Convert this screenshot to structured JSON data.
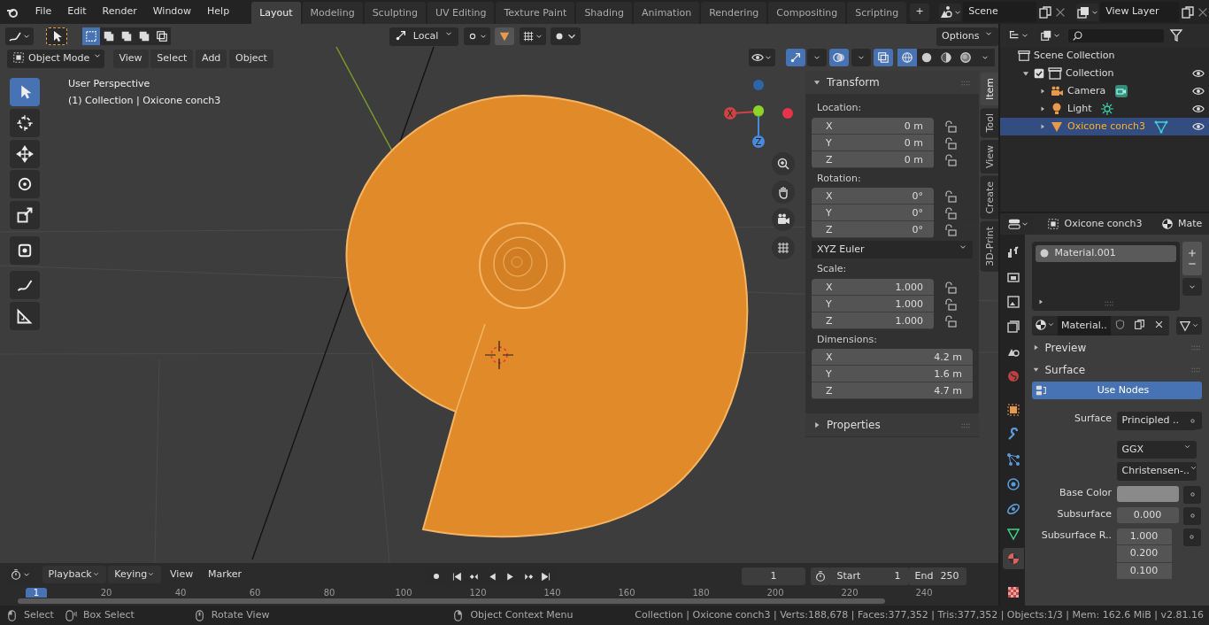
{
  "menu": [
    "File",
    "Edit",
    "Render",
    "Window",
    "Help"
  ],
  "workspaces": [
    {
      "label": "Layout",
      "selected": true
    },
    {
      "label": "Modeling",
      "selected": false
    },
    {
      "label": "Sculpting",
      "selected": false
    },
    {
      "label": "UV Editing",
      "selected": false
    },
    {
      "label": "Texture Paint",
      "selected": false
    },
    {
      "label": "Shading",
      "selected": false
    },
    {
      "label": "Animation",
      "selected": false
    },
    {
      "label": "Rendering",
      "selected": false
    },
    {
      "label": "Compositing",
      "selected": false
    },
    {
      "label": "Scripting",
      "selected": false
    }
  ],
  "add_workspace": "+",
  "scene": "Scene",
  "view_layer": "View Layer",
  "viewport": {
    "select_modes": [
      {
        "kind": "new",
        "selected": true
      },
      {
        "kind": "extend",
        "selected": false
      },
      {
        "kind": "subtract",
        "selected": false
      },
      {
        "kind": "invert",
        "selected": false
      },
      {
        "kind": "intersect",
        "selected": false
      }
    ],
    "orientation": "Local",
    "snap_on": true,
    "proportional_on": false,
    "options": "Options",
    "mode": "Object Mode",
    "menus": [
      "View",
      "Select",
      "Add",
      "Object"
    ],
    "overlay_toggles": [
      {
        "kind": "gizmo",
        "on": true
      },
      {
        "kind": "overlays",
        "on": true
      },
      {
        "kind": "xray",
        "on": true
      }
    ],
    "shading": [
      {
        "kind": "wireframe",
        "selected": true
      },
      {
        "kind": "solid",
        "selected": false
      },
      {
        "kind": "material",
        "selected": false
      },
      {
        "kind": "rendered",
        "selected": false
      }
    ],
    "info": [
      "User Perspective",
      "(1) Collection | Oxicone conch3"
    ],
    "gizmo_labels": [
      "X",
      "Z"
    ],
    "tools": [
      {
        "kind": "select",
        "selected": true
      },
      {
        "kind": "cursor",
        "selected": false
      },
      {
        "kind": "move",
        "selected": false
      },
      {
        "kind": "rotate",
        "selected": false
      },
      {
        "kind": "scale",
        "selected": false
      },
      {
        "kind": "transform",
        "selected": false
      },
      {
        "kind": "annotate",
        "selected": false
      },
      {
        "kind": "measure",
        "selected": false
      }
    ]
  },
  "sidebar": {
    "tabs": [
      {
        "label": "Item",
        "selected": true
      },
      {
        "label": "Tool",
        "selected": false
      },
      {
        "label": "View",
        "selected": false
      },
      {
        "label": "Create",
        "selected": false
      },
      {
        "label": "3D-Print",
        "selected": false
      }
    ],
    "transform": {
      "title": "Transform",
      "expanded": true,
      "groups": [
        {
          "label": "Location:",
          "locks": true,
          "rows": [
            {
              "axis": "X",
              "value": "0 m"
            },
            {
              "axis": "Y",
              "value": "0 m"
            },
            {
              "axis": "Z",
              "value": "0 m"
            }
          ]
        },
        {
          "label": "Rotation:",
          "locks": true,
          "rows": [
            {
              "axis": "X",
              "value": "0°"
            },
            {
              "axis": "Y",
              "value": "0°"
            },
            {
              "axis": "Z",
              "value": "0°"
            }
          ],
          "mode": "XYZ Euler"
        },
        {
          "label": "Scale:",
          "locks": true,
          "rows": [
            {
              "axis": "X",
              "value": "1.000"
            },
            {
              "axis": "Y",
              "value": "1.000"
            },
            {
              "axis": "Z",
              "value": "1.000"
            }
          ]
        },
        {
          "label": "Dimensions:",
          "locks": false,
          "rows": [
            {
              "axis": "X",
              "value": "4.2 m"
            },
            {
              "axis": "Y",
              "value": "1.6 m"
            },
            {
              "axis": "Z",
              "value": "4.7 m"
            }
          ]
        }
      ]
    },
    "properties": {
      "title": "Properties",
      "expanded": false
    }
  },
  "outliner": {
    "root": "Scene Collection",
    "children": [
      {
        "label": "Collection",
        "kind": "collection",
        "checked": true,
        "expanded": true,
        "selected": false,
        "children": [
          {
            "label": "Camera",
            "kind": "camera",
            "selected": false
          },
          {
            "label": "Light",
            "kind": "light",
            "selected": false
          },
          {
            "label": "Oxicone conch3",
            "kind": "mesh",
            "selected": true
          }
        ]
      }
    ]
  },
  "properties": {
    "object": "Oxicone conch3",
    "context": "Mate",
    "tabs": [
      {
        "kind": "tool",
        "selected": false
      },
      {
        "kind": "render",
        "selected": false
      },
      {
        "kind": "output",
        "selected": false
      },
      {
        "kind": "view-layer",
        "selected": false
      },
      {
        "kind": "scene",
        "selected": false
      },
      {
        "kind": "world",
        "selected": false
      },
      {
        "kind": "object",
        "selected": false
      },
      {
        "kind": "modifier",
        "selected": false
      },
      {
        "kind": "particles",
        "selected": false
      },
      {
        "kind": "physics",
        "selected": false
      },
      {
        "kind": "constraints",
        "selected": false
      },
      {
        "kind": "data",
        "selected": false
      },
      {
        "kind": "material",
        "selected": true
      },
      {
        "kind": "texture",
        "selected": false
      }
    ],
    "slots": [
      {
        "label": "Material.001",
        "selected": true
      }
    ],
    "material_name": "Material..",
    "panels": [
      {
        "title": "Preview",
        "expanded": false
      },
      {
        "title": "Surface",
        "expanded": true
      }
    ],
    "use_nodes": "Use Nodes",
    "fields": [
      {
        "kind": "socket",
        "label": "Surface",
        "value": "Principled .."
      },
      {
        "kind": "dropdown",
        "value": "GGX"
      },
      {
        "kind": "dropdown",
        "value": "Christensen-.."
      },
      {
        "kind": "color",
        "label": "Base Color"
      },
      {
        "kind": "number",
        "label": "Subsurface",
        "value": "0.000"
      },
      {
        "kind": "vector",
        "label": "Subsurface R..",
        "values": [
          "1.000",
          "0.200",
          "0.100"
        ]
      }
    ]
  },
  "timeline": {
    "menus": [
      "Playback",
      "Keying",
      "View",
      "Marker"
    ],
    "current_frame": "1",
    "start_label": "Start",
    "start": "1",
    "end_label": "End",
    "end": "250",
    "ruler": [
      "1",
      "20",
      "40",
      "60",
      "80",
      "100",
      "120",
      "140",
      "160",
      "180",
      "200",
      "220",
      "240"
    ]
  },
  "status_bar": {
    "hints": [
      {
        "kind": "left-click",
        "label": "Select"
      },
      {
        "kind": "drag",
        "label": "Box Select"
      },
      {
        "kind": "middle-click",
        "label": "Rotate View"
      },
      {
        "kind": "right-click",
        "label": "Object Context Menu"
      }
    ],
    "stats": "Collection | Oxicone conch3 | Verts:188,678 | Faces:377,352 | Tris:377,352 | Objects:1/3 | Mem: 162.6 MiB | v2.81.16"
  }
}
